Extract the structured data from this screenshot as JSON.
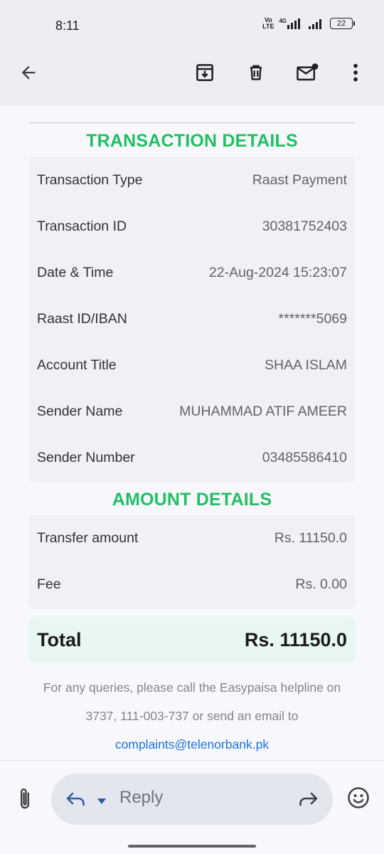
{
  "status_bar": {
    "time": "8:11",
    "network": "4G",
    "volte": "Vo LTE",
    "battery": "22"
  },
  "toolbar": {
    "icons": [
      "back-arrow-icon",
      "archive-icon",
      "delete-icon",
      "mark-unread-icon",
      "more-icon"
    ]
  },
  "transaction": {
    "title": "TRANSACTION DETAILS",
    "rows": [
      {
        "label": "Transaction Type",
        "value": "Raast Payment"
      },
      {
        "label": "Transaction ID",
        "value": "30381752403"
      },
      {
        "label": "Date & Time",
        "value": "22-Aug-2024 15:23:07"
      },
      {
        "label": "Raast ID/IBAN",
        "value": "*******5069"
      },
      {
        "label": "Account Title",
        "value": "SHAA ISLAM"
      },
      {
        "label": "Sender Name",
        "value": "MUHAMMAD ATIF AMEER"
      },
      {
        "label": "Sender Number",
        "value": "03485586410"
      }
    ]
  },
  "amount": {
    "title": "AMOUNT DETAILS",
    "rows": [
      {
        "label": "Transfer amount",
        "value": "Rs. 11150.0"
      },
      {
        "label": "Fee",
        "value": "Rs. 0.00"
      }
    ]
  },
  "total": {
    "label": "Total",
    "value": "Rs. 11150.0"
  },
  "footer": {
    "line1": "For any queries, please call the Easypaisa helpline on",
    "line2": "3737, 111-003-737 or send an email to",
    "email": "complaints@telenorbank.pk"
  },
  "reply_bar": {
    "placeholder": "Reply"
  },
  "colors": {
    "accent_green": "#21c063",
    "link_blue": "#1a73e8",
    "total_bg": "#e8f6f4"
  }
}
